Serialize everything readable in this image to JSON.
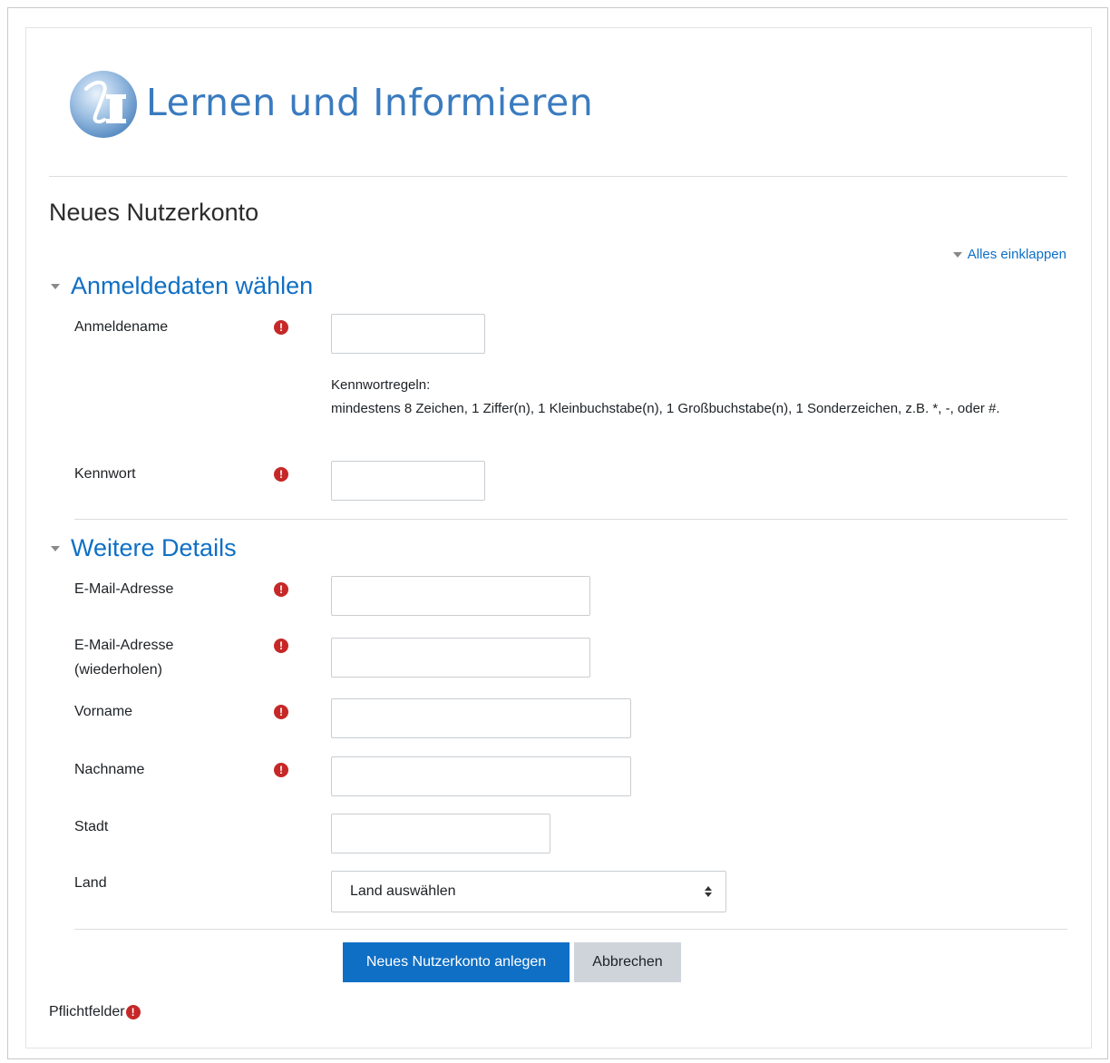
{
  "site": {
    "logo_text": "Lernen und Informieren",
    "logo_monogram": "LI",
    "brand_color": "#3a7bbf"
  },
  "page": {
    "title": "Neues Nutzerkonto",
    "collapse_all_label": "Alles einklappen"
  },
  "sections": {
    "login": {
      "title": "Anmeldedaten wählen",
      "username_label": "Anmeldename",
      "username_value": "",
      "password_rules_title": "Kennwortregeln:",
      "password_rules_text": "mindestens 8 Zeichen, 1 Ziffer(n), 1 Kleinbuchstabe(n), 1 Großbuchstabe(n), 1 Sonderzeichen, z.B. *, -, oder #.",
      "password_label": "Kennwort",
      "password_value": ""
    },
    "details": {
      "title": "Weitere Details",
      "email_label": "E-Mail-Adresse",
      "email_value": "",
      "email_repeat_label_line1": "E-Mail-Adresse",
      "email_repeat_label_line2": "(wiederholen)",
      "email_repeat_value": "",
      "firstname_label": "Vorname",
      "firstname_value": "",
      "lastname_label": "Nachname",
      "lastname_value": "",
      "city_label": "Stadt",
      "city_value": "",
      "country_label": "Land",
      "country_selected": "Land auswählen"
    }
  },
  "actions": {
    "submit_label": "Neues Nutzerkonto anlegen",
    "cancel_label": "Abbrechen"
  },
  "footer": {
    "required_note": "Pflichtfelder"
  },
  "icons": {
    "required": "exclamation-circle-icon",
    "section_toggle": "caret-down-icon"
  },
  "colors": {
    "link": "#0f6fc5",
    "required": "#c62828",
    "primary_button": "#0f6fc5",
    "secondary_button": "#ced4da"
  }
}
